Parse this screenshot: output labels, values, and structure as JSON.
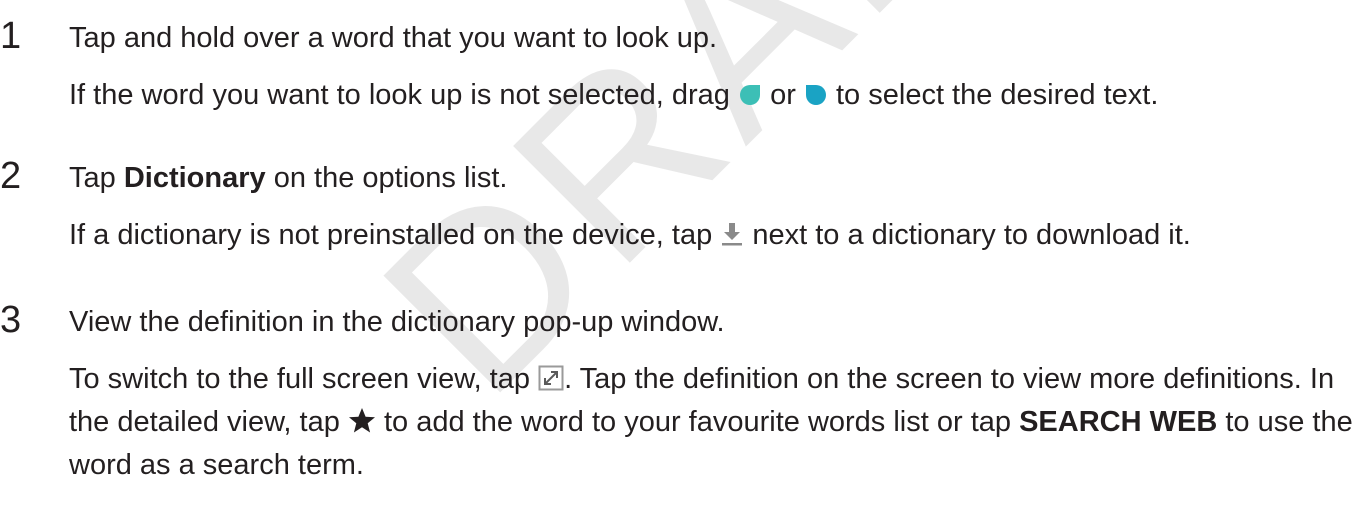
{
  "watermark": "DRAFT, Not Final",
  "steps": [
    {
      "number": "1",
      "title": "Tap and hold over a word that you want to look up.",
      "note_a": "If the word you want to look up is not selected, drag",
      "note_or": "or",
      "note_b": "to select the desired text."
    },
    {
      "number": "2",
      "title_pre": "Tap",
      "title_bold": "Dictionary",
      "title_post": "on the options list.",
      "note_a": "If a dictionary is not preinstalled on the device, tap",
      "note_b": "next to a dictionary to download it."
    },
    {
      "number": "3",
      "title": "View the definition in the dictionary pop-up window.",
      "note_a": "To switch to the full screen view, tap",
      "note_b": ". Tap the definition on the screen to view more definitions. In the detailed view, tap",
      "note_c": "to add the word to your favourite words list or tap",
      "note_bold": "SEARCH WEB",
      "note_d": "to use the word as a search term."
    }
  ],
  "colors": {
    "handle_left": "#3cbfb6",
    "handle_right": "#1aa3c4",
    "download_arrow": "#8a8a8a",
    "star": "#231f20"
  },
  "icons": [
    "left-selection-handle-icon",
    "right-selection-handle-icon",
    "download-icon",
    "full-screen-icon",
    "star-icon"
  ]
}
